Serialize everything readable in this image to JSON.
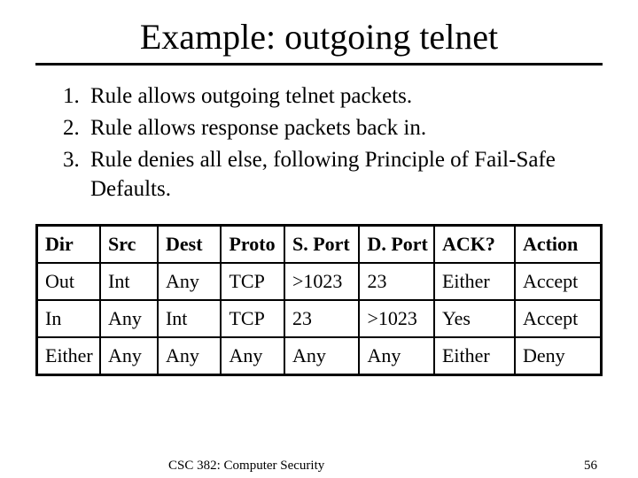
{
  "title": "Example: outgoing telnet",
  "rules": [
    "Rule allows outgoing telnet packets.",
    "Rule allows response packets back in.",
    "Rule denies all else, following Principle of Fail-Safe Defaults."
  ],
  "table": {
    "headers": [
      "Dir",
      "Src",
      "Dest",
      "Proto",
      "S. Port",
      "D. Port",
      "ACK?",
      "Action"
    ],
    "rows": [
      [
        "Out",
        "Int",
        "Any",
        "TCP",
        ">1023",
        "23",
        "Either",
        "Accept"
      ],
      [
        "In",
        "Any",
        "Int",
        "TCP",
        "23",
        ">1023",
        "Yes",
        "Accept"
      ],
      [
        "Either",
        "Any",
        "Any",
        "Any",
        "Any",
        "Any",
        "Either",
        "Deny"
      ]
    ]
  },
  "footer": {
    "course": "CSC 382: Computer Security",
    "page": "56"
  }
}
